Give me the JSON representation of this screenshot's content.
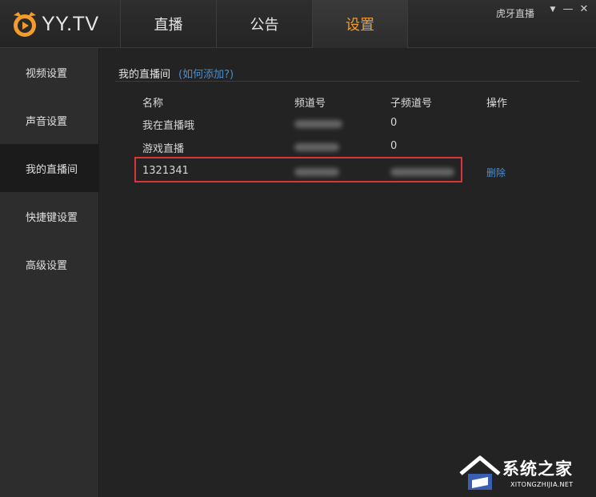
{
  "app": {
    "logo_text": "YY.TV",
    "user_name": "虎牙直播"
  },
  "window": {
    "dropdown_glyph": "▼",
    "minimize_glyph": "—",
    "close_glyph": "✕"
  },
  "nav": {
    "tabs": [
      {
        "label": "直播"
      },
      {
        "label": "公告"
      },
      {
        "label": "设置"
      }
    ],
    "active_index": 2
  },
  "sidebar": {
    "items": [
      {
        "label": "视频设置"
      },
      {
        "label": "声音设置"
      },
      {
        "label": "我的直播间"
      },
      {
        "label": "快捷键设置"
      },
      {
        "label": "高级设置"
      }
    ],
    "active_index": 2
  },
  "section": {
    "title": "我的直播间",
    "help_link": "(如何添加?)"
  },
  "table": {
    "headers": [
      "名称",
      "频道号",
      "子频道号",
      "操作"
    ],
    "rows": [
      {
        "name": "我在直播哦",
        "channel": "",
        "subchannel": "0",
        "action": ""
      },
      {
        "name": "游戏直播",
        "channel": "",
        "subchannel": "0",
        "action": ""
      },
      {
        "name": "1321341",
        "channel": "",
        "subchannel": "",
        "action": "删除"
      }
    ]
  },
  "watermark": {
    "text": "系统之家",
    "sub": "XITONGZHIJIA.NET"
  },
  "colors": {
    "accent": "#f39c2a",
    "link": "#4a8fd6",
    "highlight": "#d9353a"
  }
}
